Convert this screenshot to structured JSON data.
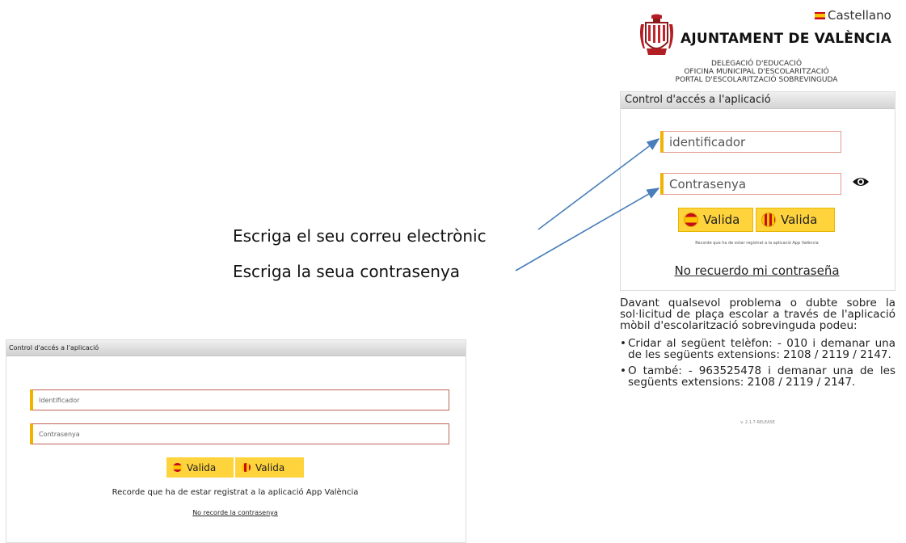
{
  "header": {
    "language_link": "Castellano",
    "org_name": "AJUNTAMENT DE VALÈNCIA",
    "sub_lines": [
      "DELEGACIÓ D'EDUCACIÓ",
      "OFICINA MUNICIPAL D'ESCOLARITZACIÓ",
      "PORTAL D'ESCOLARITZACIÓ SOBREVINGUDA"
    ]
  },
  "login": {
    "panel_title": "Control d'accés a l'aplicació",
    "id_placeholder": "identificador",
    "password_placeholder": "Contrasenya",
    "validate_es": "Valida",
    "validate_va": "Valida",
    "register_note": "Recorde que ha de estar registrat a la aplicació App València",
    "forgot_link": "No recuerdo mi contraseña"
  },
  "help": {
    "intro": "Davant qualsevol problema o dubte sobre la sol·licitud de plaça escolar a través de l'aplicació mòbil d'escolarització sobrevinguda podeu:",
    "items": [
      "Cridar al següent telèfon: - 010 i demanar una de les següents extensions: 2108 / 2119 / 2147.",
      "O també: - 963525478 i demanar una de les següents extensions: 2108 / 2119 / 2147."
    ],
    "version": "v. 2.1.7-RELEASE"
  },
  "annotations": {
    "email_hint": "Escriga el seu correu electrònic",
    "password_hint": "Escriga la seua contrasenya"
  },
  "login_old": {
    "panel_title": "Control d'accés a l'aplicació",
    "id_placeholder": "Identificador",
    "password_placeholder": "Contrasenya",
    "validate_es": "Valida",
    "validate_va": "Valida",
    "register_note": "Recorde que ha de estar registrat a la aplicació App València",
    "forgot_link": "No recorde la contrasenya"
  },
  "colors": {
    "button_yellow": "#ffd33c",
    "field_accent": "#f0b400",
    "arrow_blue": "#4a7ebb"
  }
}
